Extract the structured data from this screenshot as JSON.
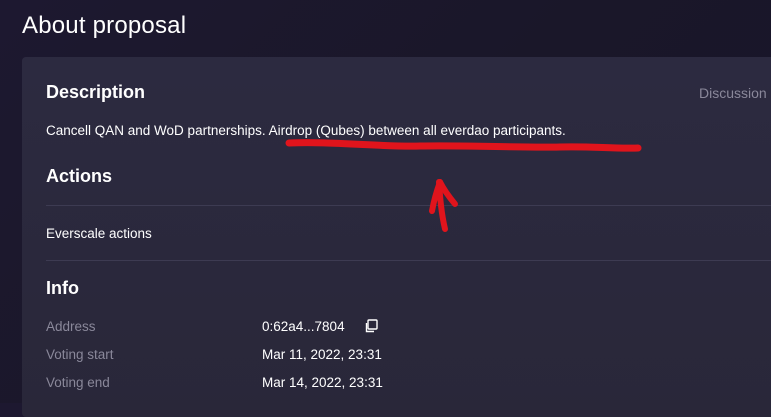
{
  "page": {
    "title": "About proposal"
  },
  "description": {
    "heading": "Description",
    "text": "Cancell QAN and WoD partnerships. Airdrop (Qubes) between all everdao participants.",
    "discussion_link": "Discussion"
  },
  "actions": {
    "heading": "Actions",
    "items": [
      "Everscale actions"
    ]
  },
  "info": {
    "heading": "Info",
    "rows": [
      {
        "label": "Address",
        "value": "0:62a4...7804"
      },
      {
        "label": "Voting start",
        "value": "Mar 11, 2022, 23:31"
      },
      {
        "label": "Voting end",
        "value": "Mar 14, 2022, 23:31"
      }
    ]
  },
  "icons": {
    "copy": "copy-icon"
  },
  "colors": {
    "annotation": "#e0141c",
    "muted_text": "#8a889a"
  }
}
